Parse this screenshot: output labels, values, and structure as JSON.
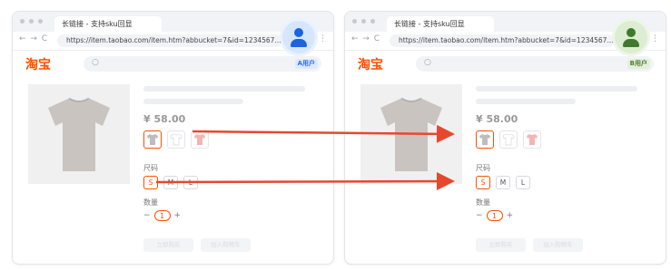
{
  "windows": [
    {
      "tab_title": "长链接 - 支持sku回显",
      "nav": "← → C",
      "url": "https://item.taobao.com/item.htm?abbucket=7&id=1234567...",
      "menu": "⋮",
      "logo": "淘宝",
      "search_icon": "○",
      "user_badge": "A用户",
      "price": "¥ 58.00",
      "size_label": "尺码",
      "sizes": [
        "S",
        "M",
        "L"
      ],
      "qty_label": "数量",
      "qty_minus": "−",
      "qty_value": "1",
      "qty_plus": "+",
      "buy_now": "立即购买",
      "add_cart": "加入购物车"
    },
    {
      "tab_title": "长链接 - 支持sku回显",
      "nav": "← → C",
      "url": "https://item.taobao.com/item.htm?abbucket=7&id=1234567...",
      "menu": "⋮",
      "logo": "淘宝",
      "search_icon": "○",
      "user_badge": "B用户",
      "price": "¥ 58.00",
      "size_label": "尺码",
      "sizes": [
        "S",
        "M",
        "L"
      ],
      "qty_label": "数量",
      "qty_minus": "−",
      "qty_value": "1",
      "qty_plus": "+",
      "buy_now": "立即购买",
      "add_cart": "加入购物车"
    }
  ],
  "colors": {
    "accent": "#ff5000",
    "user_a": "#1d63e0",
    "user_b": "#3f7a2c",
    "arrow": "#e8472d",
    "shirt_gray": "#bdbdbd",
    "shirt_white": "#ffffff",
    "shirt_pink": "#f4b4b4"
  },
  "swatch_colors": [
    "gray",
    "white",
    "pink"
  ],
  "selected": {
    "swatch": "gray",
    "size": "S"
  }
}
